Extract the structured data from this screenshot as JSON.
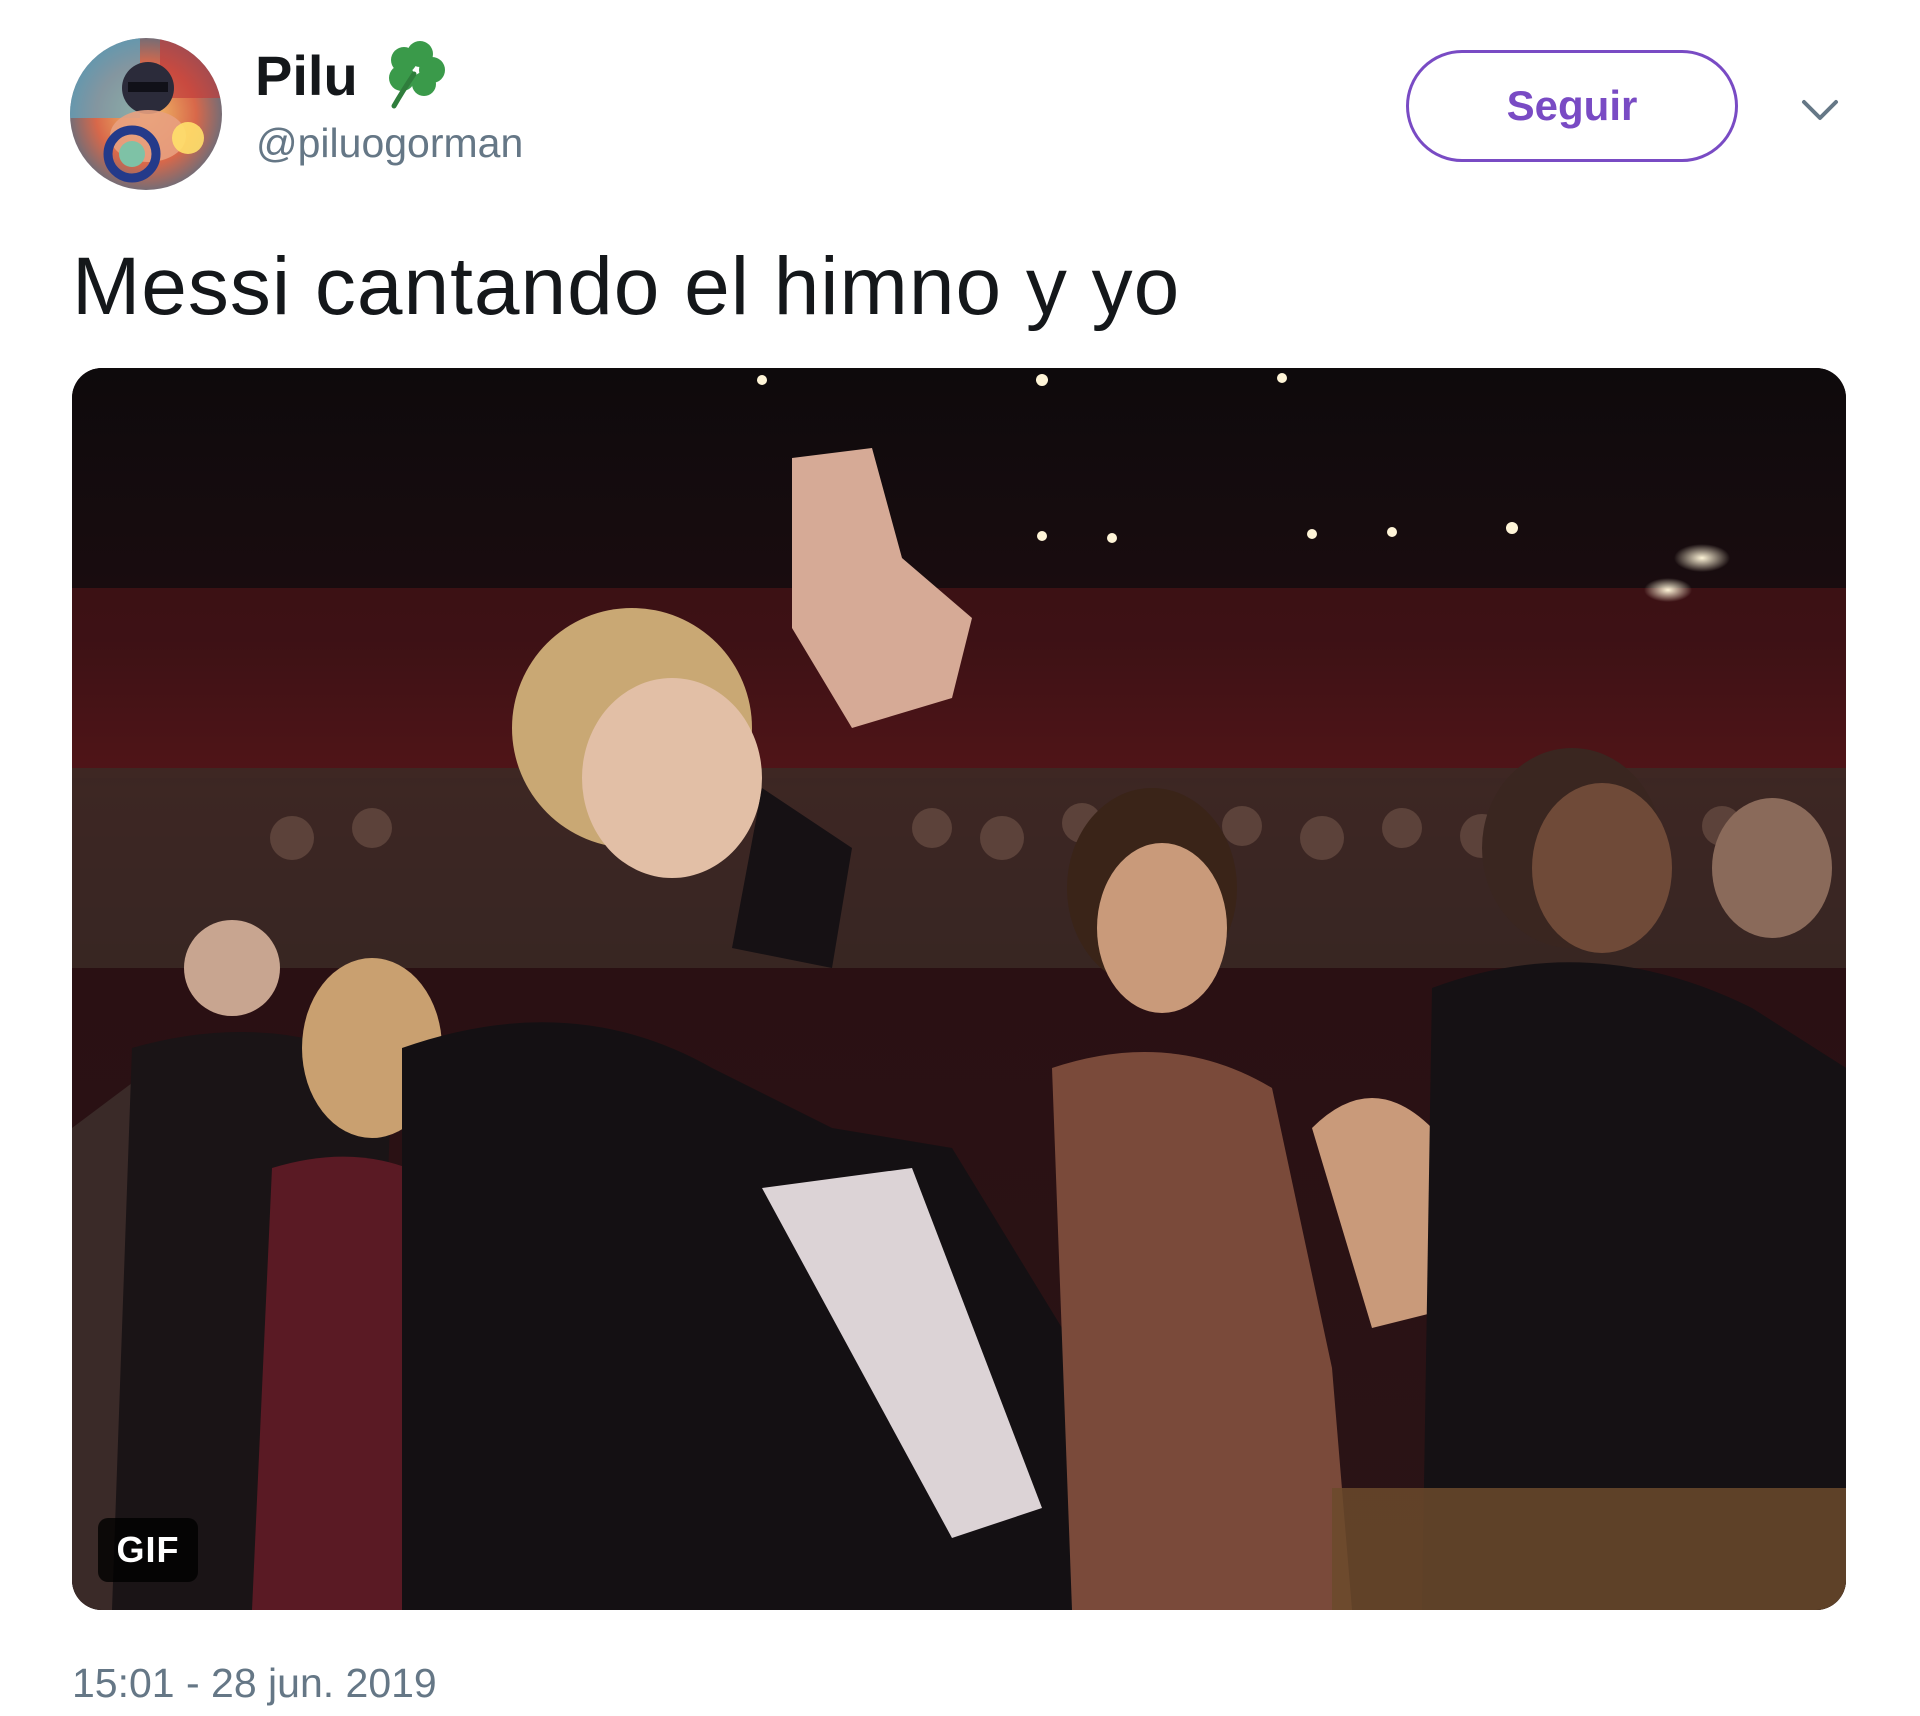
{
  "author": {
    "display_name": "Pilu",
    "handle": "@piluogorman",
    "emoji_icon": "four-leaf-clover-icon"
  },
  "follow_button": {
    "label": "Seguir"
  },
  "menu": {
    "icon": "chevron-down-icon"
  },
  "tweet": {
    "text": "Messi cantando el himno y yo",
    "timestamp": "15:01 - 28 jun. 2019"
  },
  "media": {
    "badge": "GIF"
  },
  "colors": {
    "accent": "#794bc4",
    "text_primary": "#14171a",
    "text_secondary": "#657786",
    "clover": "#3a9a4a"
  }
}
